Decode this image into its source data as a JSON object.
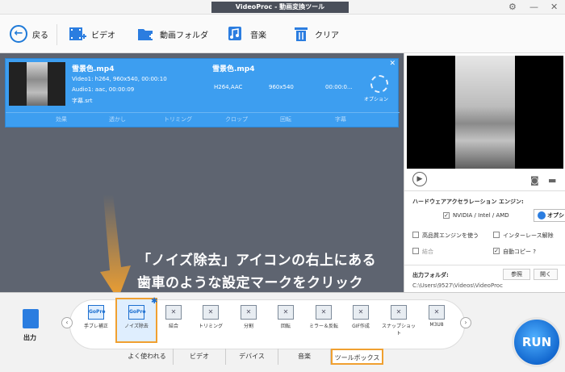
{
  "window": {
    "title": "VideoProc - 動画変換ツール"
  },
  "toolbar": {
    "back": "戻る",
    "video": "ビデオ",
    "folder": "動画フォルダ",
    "music": "音楽",
    "clear": "クリア"
  },
  "file": {
    "source_name": "雪景色.mp4",
    "video_info": "Video1: h264, 960x540, 00:00:10",
    "audio_info": "Audio1: aac, 00:00:09",
    "subtitle": "字幕.srt",
    "output_name": "雪景色.mp4",
    "codec": "H264,AAC",
    "resolution": "960x540",
    "duration": "00:00:0...",
    "option_label": "オプション",
    "edit": [
      "効果",
      "透かし",
      "トリミング",
      "クロップ",
      "回転",
      "字幕"
    ]
  },
  "callout": {
    "line1": "「ノイズ除去」アイコンの右上にある",
    "line2": "歯車のような設定マークをクリック"
  },
  "panel": {
    "hw_title": "ハードウェアアクセラレーション エンジン:",
    "nvidia": "NVIDIA / Intel / AMD",
    "option_btn": "オプション",
    "hq_engine": "高品質エンジンを使う",
    "deinterlace": "インターレース解除",
    "merge": "結合",
    "auto_copy": "自動コピー ?",
    "output_folder_label": "出力フォルダ:",
    "browse": "参照",
    "open": "開く",
    "output_path": "C:\\Users\\9527\\Videos\\VideoProc"
  },
  "bottom": {
    "output_label": "出力",
    "tools": [
      {
        "label": "手ブレ補正",
        "icon": "GoPro"
      },
      {
        "label": "ノイズ除去",
        "icon": "GoPro"
      },
      {
        "label": "結合",
        "icon": "✕"
      },
      {
        "label": "トリミング",
        "icon": "✕"
      },
      {
        "label": "分割",
        "icon": "✕"
      },
      {
        "label": "回転",
        "icon": "✕"
      },
      {
        "label": "ミラー＆反転",
        "icon": "✕"
      },
      {
        "label": "GIF作成",
        "icon": "✕"
      },
      {
        "label": "スナップショット",
        "icon": "✕"
      },
      {
        "label": "M3U8",
        "icon": "✕"
      }
    ],
    "tabs": [
      "よく使われる",
      "ビデオ",
      "デバイス",
      "音楽",
      "ツールボックス"
    ],
    "run": "RUN"
  },
  "colors": {
    "accent": "#2b7de0",
    "highlight": "#f0a030",
    "workspace": "#5e6470",
    "card": "#3d9ef0"
  }
}
